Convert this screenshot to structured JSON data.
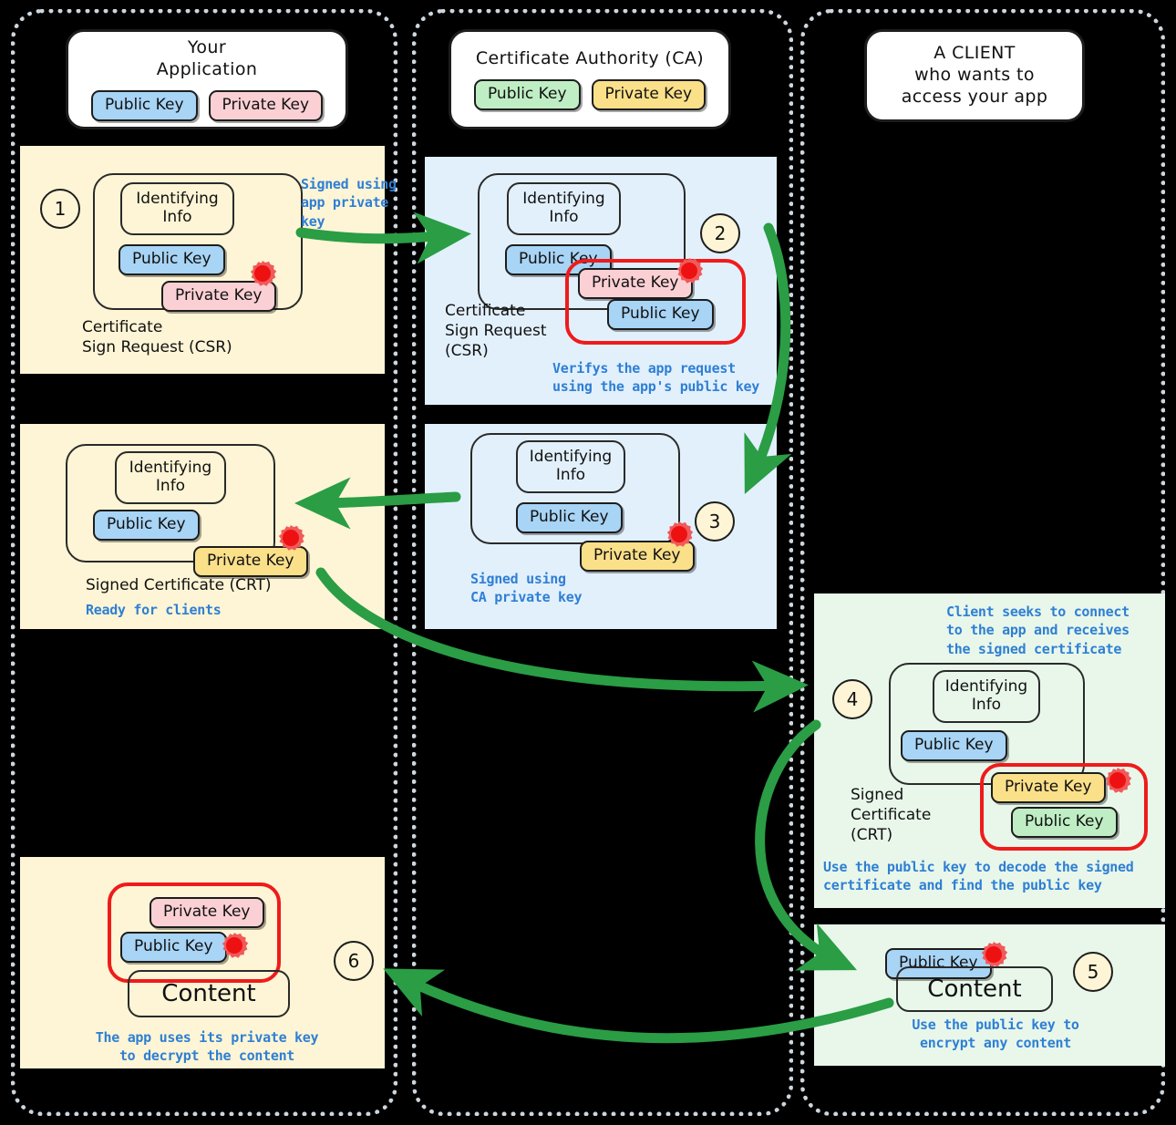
{
  "lanes": [
    {
      "name": "your-application"
    },
    {
      "name": "certificate-authority"
    },
    {
      "name": "client"
    }
  ],
  "headers": [
    {
      "title": "Your\nApplication",
      "keys": [
        {
          "label": "Public Key",
          "color": "#a8d4f5"
        },
        {
          "label": "Private Key",
          "color": "#fbd0d4"
        }
      ]
    },
    {
      "title": "Certificate Authority (CA)",
      "keys": [
        {
          "label": "Public Key",
          "color": "#bfeec4"
        },
        {
          "label": "Private Key",
          "color": "#fbe08a"
        }
      ]
    },
    {
      "title": "A CLIENT\nwho wants to\naccess your app",
      "keys": []
    }
  ],
  "steps": {
    "s1": {
      "number": "1",
      "identifying_info": "Identifying\nInfo",
      "public_key": "Public Key",
      "private_key": "Private Key",
      "caption": "Certificate\nSign Request (CSR)",
      "note": "Signed using\napp private\nkey"
    },
    "s2": {
      "number": "2",
      "identifying_info": "Identifying\nInfo",
      "public_key": "Public Key",
      "private_key": "Private Key",
      "ring_public_key": "Public Key",
      "caption": "Certificate\nSign Request\n(CSR)",
      "note": "Verifys the app request\nusing the app's public key"
    },
    "s3": {
      "number": "3",
      "identifying_info": "Identifying\nInfo",
      "public_key": "Public Key",
      "private_key": "Private Key",
      "note": "Signed using\nCA private key"
    },
    "s4_app": {
      "identifying_info": "Identifying\nInfo",
      "public_key": "Public Key",
      "private_key": "Private Key",
      "caption": "Signed Certificate (CRT)",
      "note": "Ready for clients"
    },
    "s4": {
      "number": "4",
      "top_note": "Client seeks to connect\nto the app and receives\nthe signed certificate",
      "identifying_info": "Identifying\nInfo",
      "public_key": "Public Key",
      "private_key": "Private Key",
      "ring_public_key": "Public Key",
      "caption": "Signed\nCertificate\n(CRT)",
      "note": "Use the public key to decode the signed\ncertificate and find the public key"
    },
    "s5": {
      "number": "5",
      "public_key": "Public Key",
      "content": "Content",
      "note": "Use the public key to\nencrypt any content"
    },
    "s6": {
      "number": "6",
      "private_key": "Private Key",
      "public_key": "Public Key",
      "content": "Content",
      "note": "The app uses its private key\nto decrypt the content"
    }
  },
  "colors": {
    "arrow": "#2a9d45",
    "highlight_ring": "#ef1b1b",
    "note_text": "#2f7fd4",
    "lane_border": "#cdd5dd",
    "panel_cream": "#fdf5d5",
    "panel_sky": "#e2f0fc",
    "panel_mint": "#e8f7ea",
    "seal": "#ee1111"
  }
}
